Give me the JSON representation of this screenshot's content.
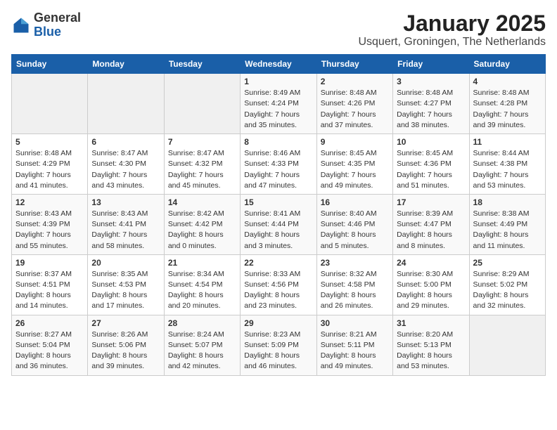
{
  "header": {
    "logo_general": "General",
    "logo_blue": "Blue",
    "title": "January 2025",
    "subtitle": "Usquert, Groningen, The Netherlands"
  },
  "weekdays": [
    "Sunday",
    "Monday",
    "Tuesday",
    "Wednesday",
    "Thursday",
    "Friday",
    "Saturday"
  ],
  "weeks": [
    [
      {
        "num": "",
        "info": ""
      },
      {
        "num": "",
        "info": ""
      },
      {
        "num": "",
        "info": ""
      },
      {
        "num": "1",
        "info": "Sunrise: 8:49 AM\nSunset: 4:24 PM\nDaylight: 7 hours\nand 35 minutes."
      },
      {
        "num": "2",
        "info": "Sunrise: 8:48 AM\nSunset: 4:26 PM\nDaylight: 7 hours\nand 37 minutes."
      },
      {
        "num": "3",
        "info": "Sunrise: 8:48 AM\nSunset: 4:27 PM\nDaylight: 7 hours\nand 38 minutes."
      },
      {
        "num": "4",
        "info": "Sunrise: 8:48 AM\nSunset: 4:28 PM\nDaylight: 7 hours\nand 39 minutes."
      }
    ],
    [
      {
        "num": "5",
        "info": "Sunrise: 8:48 AM\nSunset: 4:29 PM\nDaylight: 7 hours\nand 41 minutes."
      },
      {
        "num": "6",
        "info": "Sunrise: 8:47 AM\nSunset: 4:30 PM\nDaylight: 7 hours\nand 43 minutes."
      },
      {
        "num": "7",
        "info": "Sunrise: 8:47 AM\nSunset: 4:32 PM\nDaylight: 7 hours\nand 45 minutes."
      },
      {
        "num": "8",
        "info": "Sunrise: 8:46 AM\nSunset: 4:33 PM\nDaylight: 7 hours\nand 47 minutes."
      },
      {
        "num": "9",
        "info": "Sunrise: 8:45 AM\nSunset: 4:35 PM\nDaylight: 7 hours\nand 49 minutes."
      },
      {
        "num": "10",
        "info": "Sunrise: 8:45 AM\nSunset: 4:36 PM\nDaylight: 7 hours\nand 51 minutes."
      },
      {
        "num": "11",
        "info": "Sunrise: 8:44 AM\nSunset: 4:38 PM\nDaylight: 7 hours\nand 53 minutes."
      }
    ],
    [
      {
        "num": "12",
        "info": "Sunrise: 8:43 AM\nSunset: 4:39 PM\nDaylight: 7 hours\nand 55 minutes."
      },
      {
        "num": "13",
        "info": "Sunrise: 8:43 AM\nSunset: 4:41 PM\nDaylight: 7 hours\nand 58 minutes."
      },
      {
        "num": "14",
        "info": "Sunrise: 8:42 AM\nSunset: 4:42 PM\nDaylight: 8 hours\nand 0 minutes."
      },
      {
        "num": "15",
        "info": "Sunrise: 8:41 AM\nSunset: 4:44 PM\nDaylight: 8 hours\nand 3 minutes."
      },
      {
        "num": "16",
        "info": "Sunrise: 8:40 AM\nSunset: 4:46 PM\nDaylight: 8 hours\nand 5 minutes."
      },
      {
        "num": "17",
        "info": "Sunrise: 8:39 AM\nSunset: 4:47 PM\nDaylight: 8 hours\nand 8 minutes."
      },
      {
        "num": "18",
        "info": "Sunrise: 8:38 AM\nSunset: 4:49 PM\nDaylight: 8 hours\nand 11 minutes."
      }
    ],
    [
      {
        "num": "19",
        "info": "Sunrise: 8:37 AM\nSunset: 4:51 PM\nDaylight: 8 hours\nand 14 minutes."
      },
      {
        "num": "20",
        "info": "Sunrise: 8:35 AM\nSunset: 4:53 PM\nDaylight: 8 hours\nand 17 minutes."
      },
      {
        "num": "21",
        "info": "Sunrise: 8:34 AM\nSunset: 4:54 PM\nDaylight: 8 hours\nand 20 minutes."
      },
      {
        "num": "22",
        "info": "Sunrise: 8:33 AM\nSunset: 4:56 PM\nDaylight: 8 hours\nand 23 minutes."
      },
      {
        "num": "23",
        "info": "Sunrise: 8:32 AM\nSunset: 4:58 PM\nDaylight: 8 hours\nand 26 minutes."
      },
      {
        "num": "24",
        "info": "Sunrise: 8:30 AM\nSunset: 5:00 PM\nDaylight: 8 hours\nand 29 minutes."
      },
      {
        "num": "25",
        "info": "Sunrise: 8:29 AM\nSunset: 5:02 PM\nDaylight: 8 hours\nand 32 minutes."
      }
    ],
    [
      {
        "num": "26",
        "info": "Sunrise: 8:27 AM\nSunset: 5:04 PM\nDaylight: 8 hours\nand 36 minutes."
      },
      {
        "num": "27",
        "info": "Sunrise: 8:26 AM\nSunset: 5:06 PM\nDaylight: 8 hours\nand 39 minutes."
      },
      {
        "num": "28",
        "info": "Sunrise: 8:24 AM\nSunset: 5:07 PM\nDaylight: 8 hours\nand 42 minutes."
      },
      {
        "num": "29",
        "info": "Sunrise: 8:23 AM\nSunset: 5:09 PM\nDaylight: 8 hours\nand 46 minutes."
      },
      {
        "num": "30",
        "info": "Sunrise: 8:21 AM\nSunset: 5:11 PM\nDaylight: 8 hours\nand 49 minutes."
      },
      {
        "num": "31",
        "info": "Sunrise: 8:20 AM\nSunset: 5:13 PM\nDaylight: 8 hours\nand 53 minutes."
      },
      {
        "num": "",
        "info": ""
      }
    ]
  ]
}
